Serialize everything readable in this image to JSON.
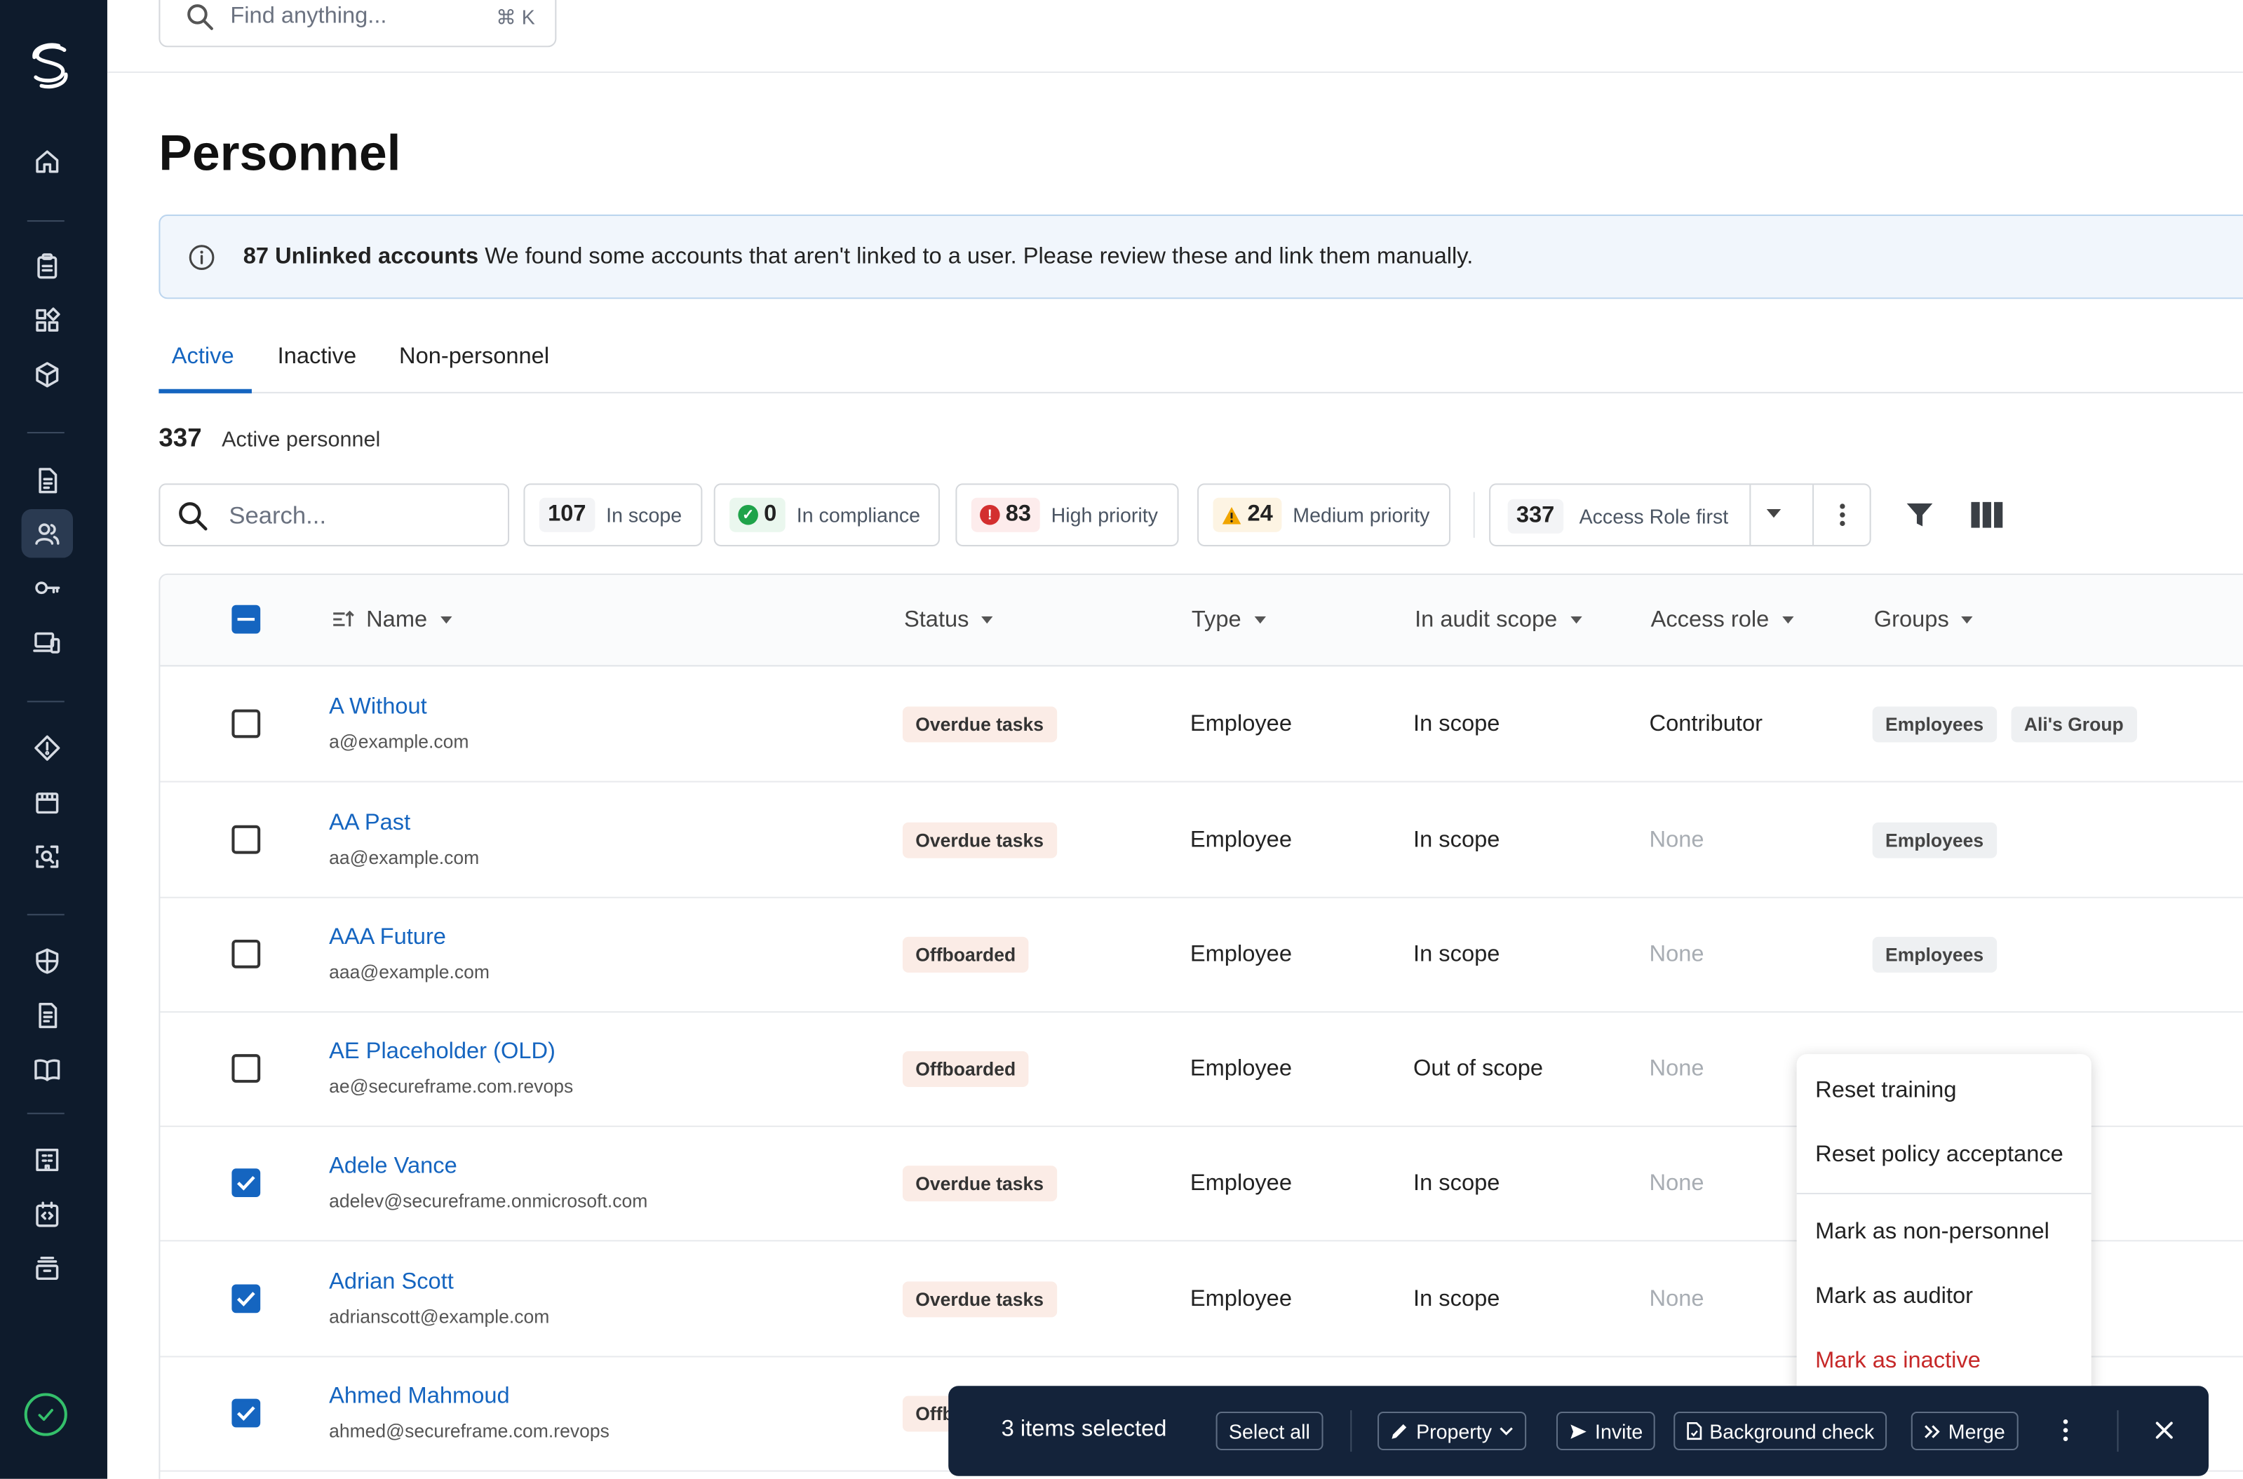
{
  "search": {
    "placeholder": "Find anything...",
    "shortcut": "⌘ K"
  },
  "page": {
    "title": "Personnel"
  },
  "banner": {
    "bold": "87 Unlinked accounts",
    "text": " We found some accounts that aren't linked to a user. Please review these and link them manually."
  },
  "tabs": [
    {
      "label": "Active"
    },
    {
      "label": "Inactive"
    },
    {
      "label": "Non-personnel"
    }
  ],
  "summary": {
    "count": "337",
    "label": "Active personnel"
  },
  "filters": {
    "search_placeholder": "Search...",
    "chips": [
      {
        "count": "107",
        "label": "In scope"
      },
      {
        "count": "0",
        "label": "In compliance",
        "status_color": "#1fa34a"
      },
      {
        "count": "83",
        "label": "High priority",
        "status_color": "#d32f2f"
      },
      {
        "count": "24",
        "label": "Medium priority",
        "status_color": "#f0a500"
      }
    ],
    "sort": {
      "count": "337",
      "label": "Access Role first"
    }
  },
  "table": {
    "columns": [
      "Name",
      "Status",
      "Type",
      "In audit scope",
      "Access role",
      "Groups"
    ],
    "rows": [
      {
        "name": "A Without",
        "email": "a@example.com",
        "status": "Overdue tasks",
        "type": "Employee",
        "scope": "In scope",
        "role": "Contributor",
        "groups": [
          "Employees",
          "Ali's Group"
        ],
        "checked": false
      },
      {
        "name": "AA Past",
        "email": "aa@example.com",
        "status": "Overdue tasks",
        "type": "Employee",
        "scope": "In scope",
        "role": "None",
        "groups": [
          "Employees"
        ],
        "checked": false
      },
      {
        "name": "AAA Future",
        "email": "aaa@example.com",
        "status": "Offboarded",
        "type": "Employee",
        "scope": "In scope",
        "role": "None",
        "groups": [
          "Employees"
        ],
        "checked": false
      },
      {
        "name": "AE Placeholder (OLD)",
        "email": "ae@secureframe.com.revops",
        "status": "Offboarded",
        "type": "Employee",
        "scope": "Out of scope",
        "role": "None",
        "groups": [],
        "checked": false
      },
      {
        "name": "Adele Vance",
        "email": "adelev@secureframe.onmicrosoft.com",
        "status": "Overdue tasks",
        "type": "Employee",
        "scope": "In scope",
        "role": "None",
        "groups": [],
        "checked": true
      },
      {
        "name": "Adrian Scott",
        "email": "adrianscott@example.com",
        "status": "Overdue tasks",
        "type": "Employee",
        "scope": "In scope",
        "role": "None",
        "groups": [],
        "checked": true
      },
      {
        "name": "Ahmed Mahmoud",
        "email": "ahmed@secureframe.com.revops",
        "status": "Offboarded",
        "type": "",
        "scope": "",
        "role": "",
        "groups": [],
        "checked": true
      }
    ]
  },
  "menu": {
    "items": [
      {
        "label": "Reset training"
      },
      {
        "label": "Reset policy acceptance"
      },
      {
        "label": "Mark as non-personnel"
      },
      {
        "label": "Mark as auditor"
      },
      {
        "label": "Mark as inactive",
        "danger": true
      }
    ]
  },
  "actionbar": {
    "selected": "3 items selected",
    "select_all": "Select all",
    "property": "Property",
    "invite": "Invite",
    "background_check": "Background check",
    "merge": "Merge"
  },
  "colors": {
    "accent": "#1565c0",
    "sidebar": "#0e1b2c",
    "danger": "#c62828",
    "ok": "#34c06b"
  }
}
